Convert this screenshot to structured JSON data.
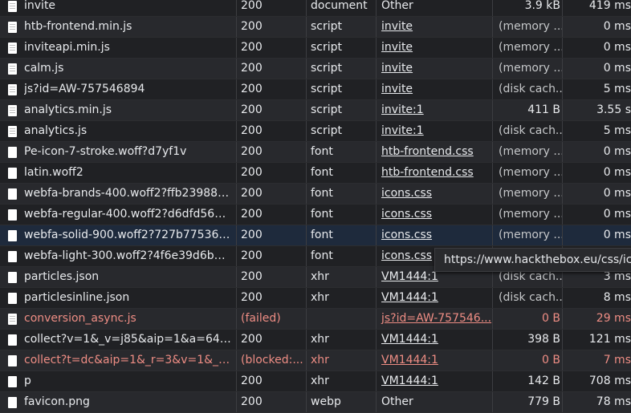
{
  "network": {
    "requests": [
      {
        "name": "invite",
        "status": "200",
        "type": "document",
        "initiator": "Other",
        "initiator_link": false,
        "size": "3.9 kB",
        "time": "419 ms",
        "icon": "document-icon",
        "failed": false
      },
      {
        "name": "htb-frontend.min.js",
        "status": "200",
        "type": "script",
        "initiator": "invite",
        "initiator_link": true,
        "size": "(memory ...",
        "time": "0 ms",
        "icon": "script-file-icon",
        "failed": false
      },
      {
        "name": "inviteapi.min.js",
        "status": "200",
        "type": "script",
        "initiator": "invite",
        "initiator_link": true,
        "size": "(memory ...",
        "time": "0 ms",
        "icon": "script-file-icon",
        "failed": false
      },
      {
        "name": "calm.js",
        "status": "200",
        "type": "script",
        "initiator": "invite",
        "initiator_link": true,
        "size": "(memory ...",
        "time": "0 ms",
        "icon": "script-file-icon",
        "failed": false
      },
      {
        "name": "js?id=AW-757546894",
        "status": "200",
        "type": "script",
        "initiator": "invite",
        "initiator_link": true,
        "size": "(disk cach...",
        "time": "5 ms",
        "icon": "script-file-icon",
        "failed": false
      },
      {
        "name": "analytics.min.js",
        "status": "200",
        "type": "script",
        "initiator": "invite:1",
        "initiator_link": true,
        "size": "411 B",
        "time": "3.55 s",
        "icon": "script-file-icon",
        "failed": false
      },
      {
        "name": "analytics.js",
        "status": "200",
        "type": "script",
        "initiator": "invite:1",
        "initiator_link": true,
        "size": "(disk cach...",
        "time": "5 ms",
        "icon": "script-file-icon",
        "failed": false
      },
      {
        "name": "Pe-icon-7-stroke.woff?d7yf1v",
        "status": "200",
        "type": "font",
        "initiator": "htb-frontend.css",
        "initiator_link": true,
        "size": "(memory ...",
        "time": "0 ms",
        "icon": "font-file-icon",
        "failed": false
      },
      {
        "name": "latin.woff2",
        "status": "200",
        "type": "font",
        "initiator": "htb-frontend.css",
        "initiator_link": true,
        "size": "(memory ...",
        "time": "0 ms",
        "icon": "font-file-icon",
        "failed": false
      },
      {
        "name": "webfa-brands-400.woff2?ffb2398835...",
        "status": "200",
        "type": "font",
        "initiator": "icons.css",
        "initiator_link": true,
        "size": "(memory ...",
        "time": "0 ms",
        "icon": "font-file-icon",
        "failed": false
      },
      {
        "name": "webfa-regular-400.woff2?d6dfd56d6...",
        "status": "200",
        "type": "font",
        "initiator": "icons.css",
        "initiator_link": true,
        "size": "(memory ...",
        "time": "0 ms",
        "icon": "font-file-icon",
        "failed": false
      },
      {
        "name": "webfa-solid-900.woff2?727b77536bb...",
        "status": "200",
        "type": "font",
        "initiator": "icons.css",
        "initiator_link": true,
        "size": "(memory ...",
        "time": "0 ms",
        "icon": "font-file-icon",
        "failed": false
      },
      {
        "name": "webfa-light-300.woff2?4f6e39d6b47...",
        "status": "200",
        "type": "font",
        "initiator": "icons.css",
        "initiator_link": true,
        "size": "",
        "time": "",
        "icon": "font-file-icon",
        "failed": false
      },
      {
        "name": "particles.json",
        "status": "200",
        "type": "xhr",
        "initiator": "VM1444:1",
        "initiator_link": true,
        "size": "(disk cach...",
        "time": "3 ms",
        "icon": "data-file-icon",
        "failed": false
      },
      {
        "name": "particlesinline.json",
        "status": "200",
        "type": "xhr",
        "initiator": "VM1444:1",
        "initiator_link": true,
        "size": "(disk cach...",
        "time": "8 ms",
        "icon": "data-file-icon",
        "failed": false
      },
      {
        "name": "conversion_async.js",
        "status": "(failed)",
        "type": "",
        "initiator": "js?id=AW-757546...",
        "initiator_link": true,
        "size": "0 B",
        "time": "29 ms",
        "icon": "script-file-icon",
        "failed": true
      },
      {
        "name": "collect?v=1&_v=j85&aip=1&a=6466...",
        "status": "200",
        "type": "xhr",
        "initiator": "VM1444:1",
        "initiator_link": true,
        "size": "398 B",
        "time": "121 ms",
        "icon": "data-file-icon",
        "failed": false
      },
      {
        "name": "collect?t=dc&aip=1&_r=3&v=1&_v=...",
        "status": "(blocked:...",
        "type": "xhr",
        "initiator": "VM1444:1",
        "initiator_link": true,
        "size": "0 B",
        "time": "7 ms",
        "icon": "data-file-icon",
        "failed": true
      },
      {
        "name": "p",
        "status": "200",
        "type": "xhr",
        "initiator": "VM1444:1",
        "initiator_link": true,
        "size": "142 B",
        "time": "708 ms",
        "icon": "data-file-icon",
        "failed": false
      },
      {
        "name": "favicon.png",
        "status": "200",
        "type": "webp",
        "initiator": "Other",
        "initiator_link": false,
        "size": "779 B",
        "time": "78 ms",
        "icon": "image-file-icon",
        "failed": false
      }
    ],
    "selected_index": 11,
    "tooltip": "https://www.hackthebox.eu/css/icons.css"
  },
  "colors": {
    "background": "#202124",
    "row_alt": "#28292d",
    "row_selected": "#1e2a3c",
    "failed_text": "#ee8d84",
    "text": "#e8eaed"
  }
}
